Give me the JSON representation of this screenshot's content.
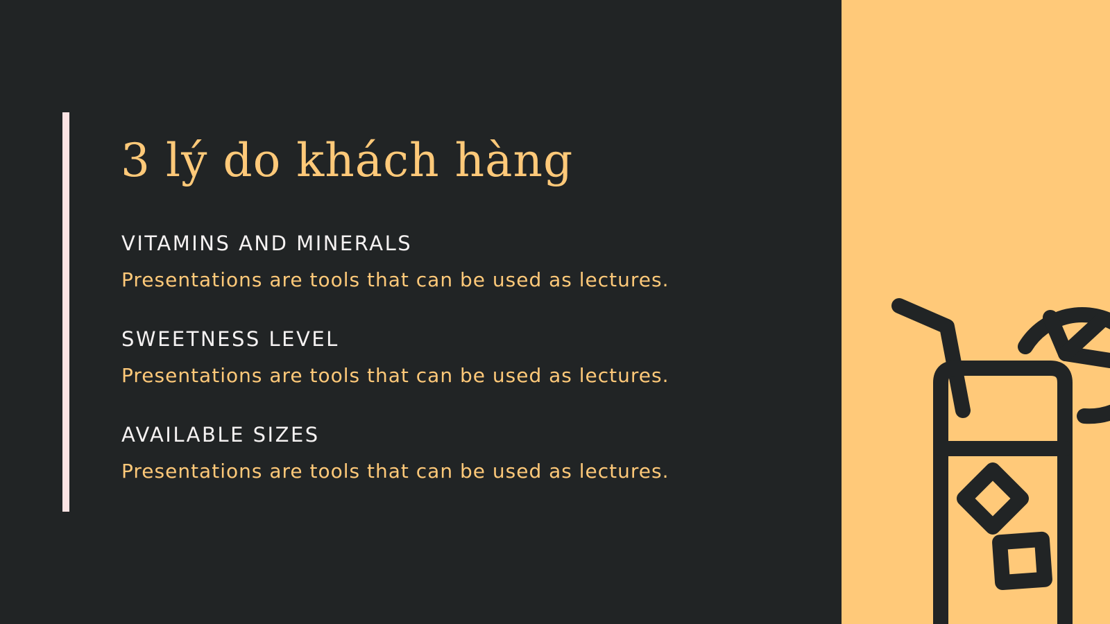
{
  "slide": {
    "title": "3 lý do khách hàng",
    "reasons": [
      {
        "heading": "VITAMINS AND MINERALS",
        "text": "Presentations are tools that can be used as lectures."
      },
      {
        "heading": "SWEETNESS LEVEL",
        "text": "Presentations are tools that can be used as lectures."
      },
      {
        "heading": "AVAILABLE SIZES",
        "text": "Presentations are tools that can be used as lectures."
      }
    ]
  },
  "colors": {
    "background": "#212425",
    "accent": "#FFC979",
    "heading_text": "#F5F2F2",
    "bar": "#FCE3E3"
  },
  "icons": {
    "illustration": "drink-glass-icon"
  }
}
